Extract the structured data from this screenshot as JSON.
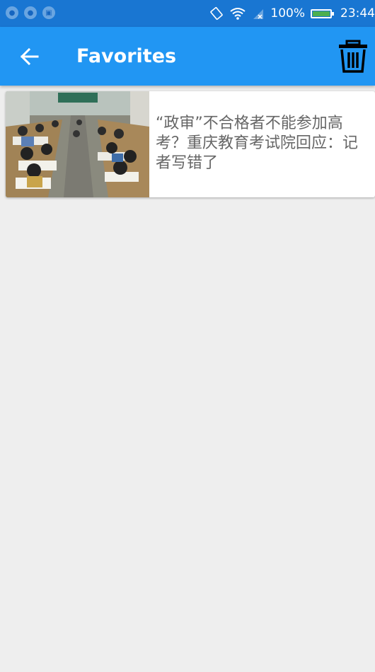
{
  "status_bar": {
    "battery_percent": "100%",
    "time": "23:44",
    "battery_level": 1.0,
    "icons": [
      "notification-icon",
      "notification-icon",
      "image-icon",
      "rotate-icon",
      "wifi-icon",
      "signal-icon",
      "battery-icon"
    ]
  },
  "app_bar": {
    "title": "Favorites",
    "color": "#2196f3"
  },
  "favorites": [
    {
      "headline": "“政审”不合格者不能参加高考？重庆教育考试院回应：记者写错了",
      "thumbnail": "classroom-exam-photo"
    }
  ]
}
